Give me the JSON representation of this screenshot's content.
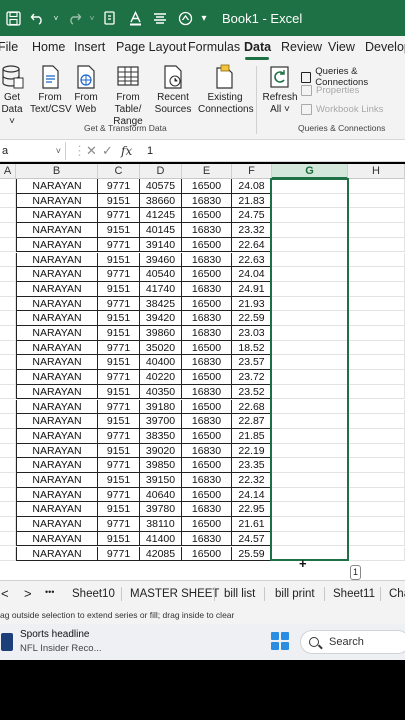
{
  "window": {
    "title": "Book1 - Excel",
    "quick_access": {
      "save": "save-icon",
      "undo": "undo-icon",
      "redo": "redo-icon",
      "format": "format-icon",
      "font_color": "font-color-icon",
      "align": "align-icon",
      "shape": "shape-icon"
    }
  },
  "ribbon_tabs": [
    {
      "label": "File"
    },
    {
      "label": "Home"
    },
    {
      "label": "Insert"
    },
    {
      "label": "Page Layout"
    },
    {
      "label": "Formulas"
    },
    {
      "label": "Data"
    },
    {
      "label": "Review"
    },
    {
      "label": "View"
    },
    {
      "label": "Developer"
    }
  ],
  "active_tab": "Data",
  "ribbon": {
    "get_data": {
      "line1": "Get",
      "line2": "Data ˅"
    },
    "from_text": {
      "line1": "From",
      "line2": "Text/CSV"
    },
    "from_web": {
      "line1": "From",
      "line2": "Web"
    },
    "from_table": {
      "line1": "From Table/",
      "line2": "Range"
    },
    "recent_sources": {
      "line1": "Recent",
      "line2": "Sources"
    },
    "existing_connections": {
      "line1": "Existing",
      "line2": "Connections"
    },
    "refresh_all": {
      "line1": "Refresh",
      "line2": "All ˅"
    },
    "queries_connections": "Queries & Connections",
    "properties": "Properties",
    "workbook_links": "Workbook Links",
    "group_get_transform": "Get & Transform Data",
    "group_queries": "Queries & Connections"
  },
  "formula_bar": {
    "name_box": "a",
    "cancel": "✕",
    "enter": "✓",
    "fx": "fx",
    "value": "1"
  },
  "columns": [
    "A",
    "B",
    "C",
    "D",
    "E",
    "F",
    "G",
    "H"
  ],
  "selected_column": "G",
  "rows": [
    [
      "NARAYAN",
      "9771",
      "40575",
      "16500",
      "24.08"
    ],
    [
      "NARAYAN",
      "9151",
      "38660",
      "16830",
      "21.83"
    ],
    [
      "NARAYAN",
      "9771",
      "41245",
      "16500",
      "24.75"
    ],
    [
      "NARAYAN",
      "9151",
      "40145",
      "16830",
      "23.32"
    ],
    [
      "NARAYAN",
      "9771",
      "39140",
      "16500",
      "22.64"
    ],
    [
      "NARAYAN",
      "9151",
      "39460",
      "16830",
      "22.63"
    ],
    [
      "NARAYAN",
      "9771",
      "40540",
      "16500",
      "24.04"
    ],
    [
      "NARAYAN",
      "9151",
      "41740",
      "16830",
      "24.91"
    ],
    [
      "NARAYAN",
      "9771",
      "38425",
      "16500",
      "21.93"
    ],
    [
      "NARAYAN",
      "9151",
      "39420",
      "16830",
      "22.59"
    ],
    [
      "NARAYAN",
      "9151",
      "39860",
      "16830",
      "23.03"
    ],
    [
      "NARAYAN",
      "9771",
      "35020",
      "16500",
      "18.52"
    ],
    [
      "NARAYAN",
      "9151",
      "40400",
      "16830",
      "23.57"
    ],
    [
      "NARAYAN",
      "9771",
      "40220",
      "16500",
      "23.72"
    ],
    [
      "NARAYAN",
      "9151",
      "40350",
      "16830",
      "23.52"
    ],
    [
      "NARAYAN",
      "9771",
      "39180",
      "16500",
      "22.68"
    ],
    [
      "NARAYAN",
      "9151",
      "39700",
      "16830",
      "22.87"
    ],
    [
      "NARAYAN",
      "9771",
      "38350",
      "16500",
      "21.85"
    ],
    [
      "NARAYAN",
      "9151",
      "39020",
      "16830",
      "22.19"
    ],
    [
      "NARAYAN",
      "9771",
      "39850",
      "16500",
      "23.35"
    ],
    [
      "NARAYAN",
      "9151",
      "39150",
      "16830",
      "22.32"
    ],
    [
      "NARAYAN",
      "9771",
      "40640",
      "16500",
      "24.14"
    ],
    [
      "NARAYAN",
      "9151",
      "39780",
      "16830",
      "22.95"
    ],
    [
      "NARAYAN",
      "9771",
      "38110",
      "16500",
      "21.61"
    ],
    [
      "NARAYAN",
      "9151",
      "41400",
      "16830",
      "24.57"
    ],
    [
      "NARAYAN",
      "9771",
      "42085",
      "16500",
      "25.59"
    ]
  ],
  "fill_badge": "1",
  "sheet_nav": {
    "prev": "<",
    "next": ">",
    "more": "•••"
  },
  "sheet_tabs": [
    "Sheet10",
    "MASTER SHEET",
    "bill list",
    "bill print",
    "Sheet11",
    "Cha"
  ],
  "status_text": "ag outside selection to extend series or fill; drag inside to clear",
  "taskbar": {
    "news_title": "Sports headline",
    "news_sub": "NFL Insider Reco...",
    "search_label": "Search"
  },
  "colors": {
    "excel_green": "#1e7145",
    "selection": "#1e7145"
  }
}
